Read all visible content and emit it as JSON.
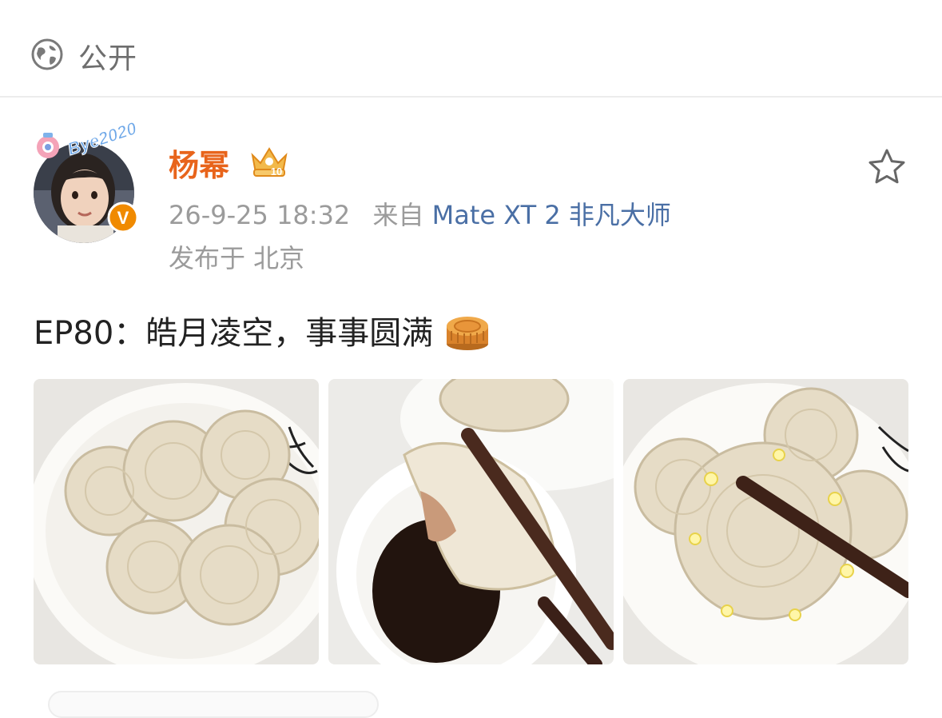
{
  "visibility": {
    "label": "公开",
    "icon": "globe-icon"
  },
  "author": {
    "name": "杨幂",
    "avatar_caption": "Bye2020",
    "verified_badge": "V",
    "vip_badge_text": "10"
  },
  "post": {
    "time": "26-9-25 18:32",
    "source_prefix": "来自",
    "source_device": "Mate XT 2 非凡大师",
    "location": "发布于 北京",
    "text": "EP80：皓月凌空，事事圆满",
    "emoji": "mooncake"
  },
  "images": [
    {
      "name": "dumplings-on-plate"
    },
    {
      "name": "dumpling-dipped-in-sauce"
    },
    {
      "name": "dumplings-with-chopsticks"
    }
  ],
  "colors": {
    "username": "#e8641b",
    "device_link": "#4a6fa5",
    "meta": "#9b9b9b",
    "badge_orange": "#f08a00"
  }
}
